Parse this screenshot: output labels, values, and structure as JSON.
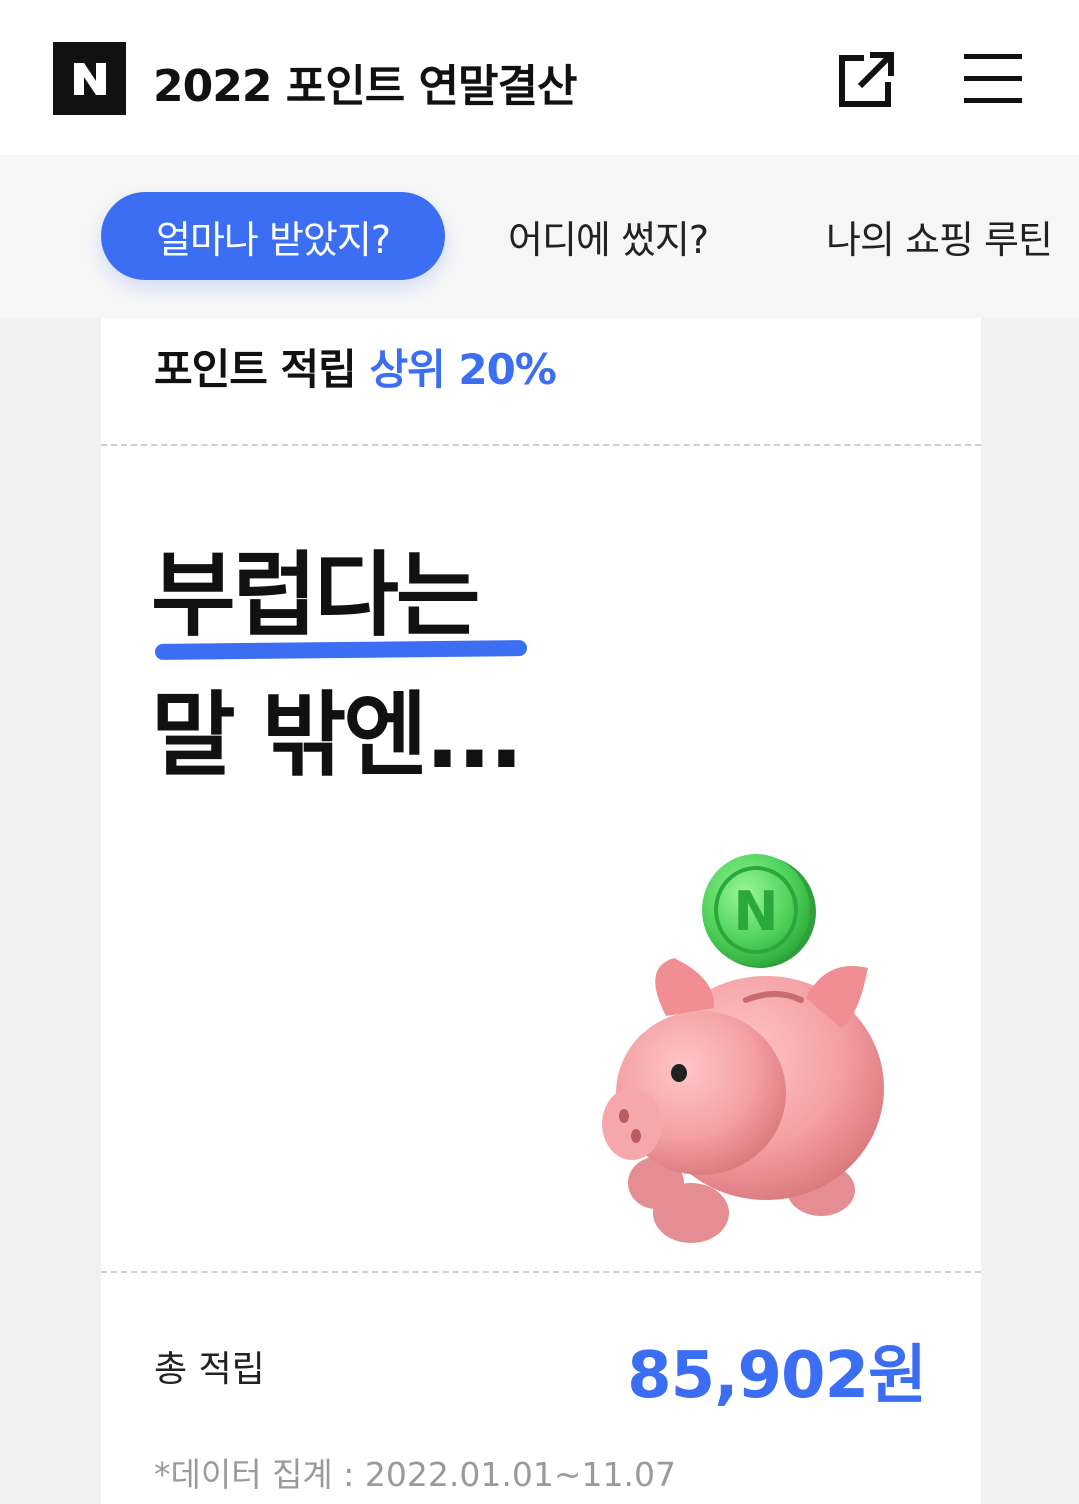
{
  "header": {
    "logo_letter": "N",
    "title": "2022 포인트 연말결산",
    "share_icon": "share-icon",
    "menu_icon": "hamburger-menu-icon"
  },
  "tabs": [
    {
      "label": "얼마나 받았지?",
      "active": true
    },
    {
      "label": "어디에 썼지?",
      "active": false
    },
    {
      "label": "나의 쇼핑 루틴",
      "active": false
    }
  ],
  "card": {
    "rank_prefix": "포인트 적립",
    "rank_highlight": "상위 20%",
    "headline_line1": "부럽다는",
    "headline_line2": "말 밖엔...",
    "illustration": "piggy-bank-with-coin",
    "total_label": "총 적립",
    "total_value": "85,902원",
    "footnote": "*데이터 집계 : 2022.01.01~11.07"
  },
  "colors": {
    "accent": "#3b6ef2",
    "piggy": "#f4a0a4",
    "coin": "#4fd35a"
  }
}
